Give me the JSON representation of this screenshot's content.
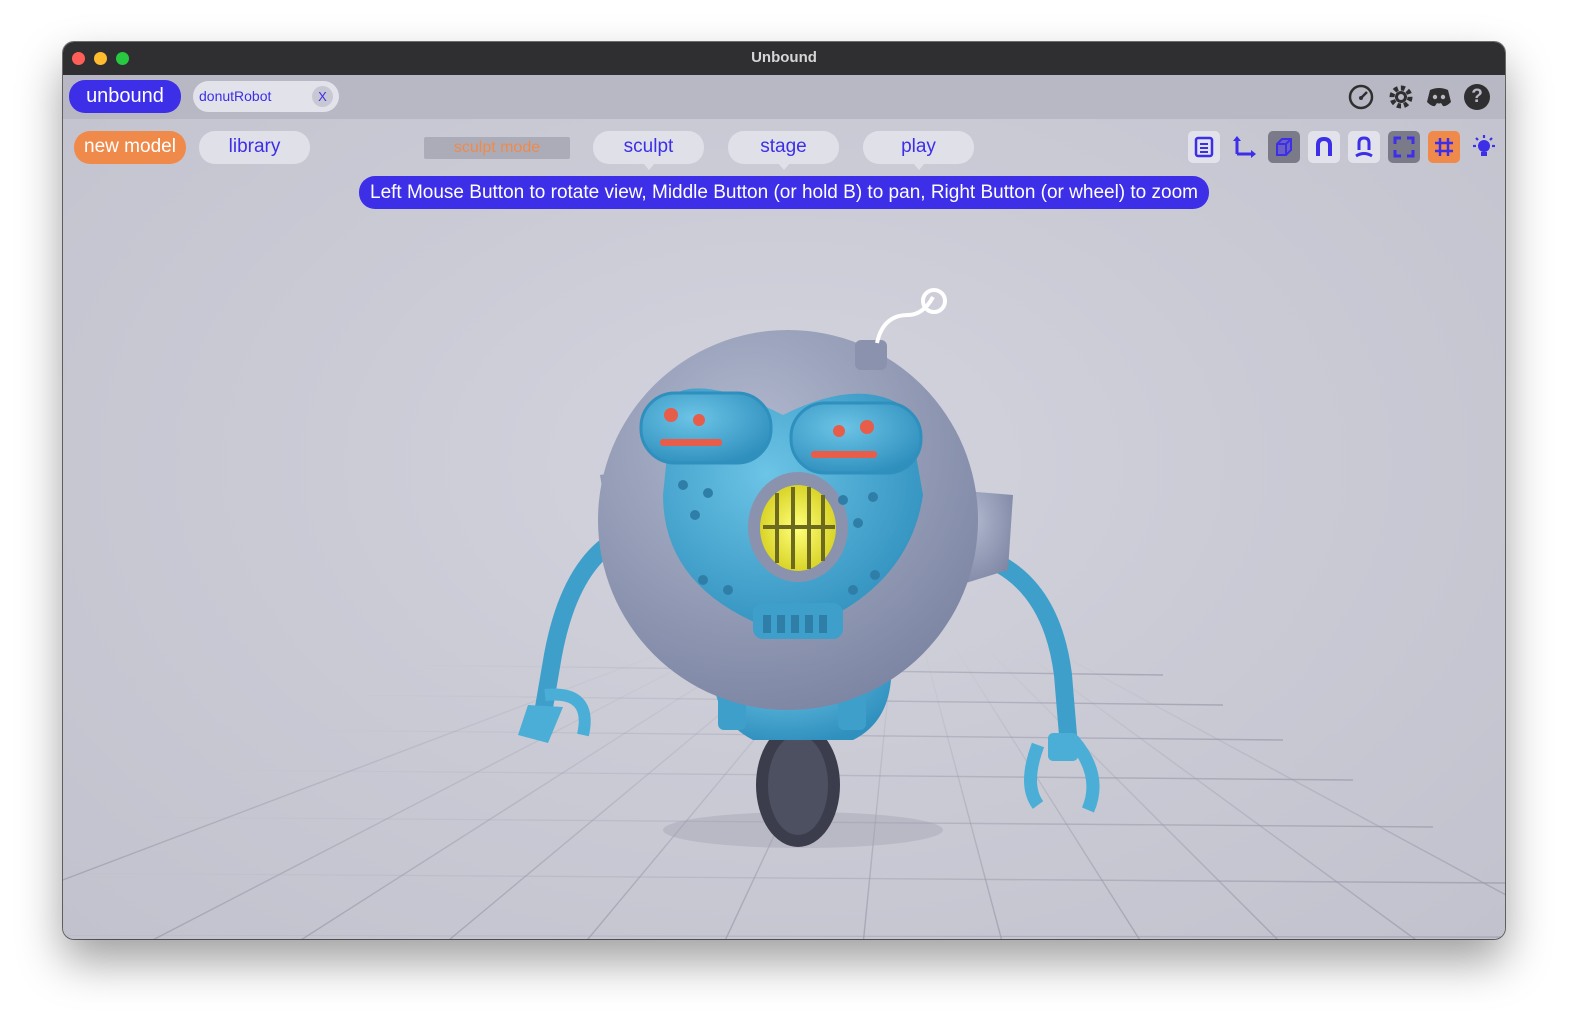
{
  "window": {
    "title": "Unbound"
  },
  "tabs": {
    "app_tab": "unbound",
    "document_tab": {
      "label": "donutRobot",
      "close_label": "X"
    }
  },
  "top_right_icons": [
    "performance-icon",
    "settings-icon",
    "discord-icon",
    "help-icon"
  ],
  "help_glyph": "?",
  "toolbar": {
    "new_model": "new model",
    "library": "library",
    "sculpt_mode": "sculpt mode",
    "modes": [
      "sculpt",
      "stage",
      "play"
    ]
  },
  "hint": "Left Mouse Button to rotate view, Middle Button (or hold B) to pan, Right Button (or wheel) to zoom",
  "view_tools": [
    {
      "icon": "outline-list-icon",
      "active": false
    },
    {
      "icon": "axis-gizmo-icon",
      "active": false
    },
    {
      "icon": "wireframe-cube-icon",
      "active": true
    },
    {
      "icon": "magnet-icon",
      "active": false
    },
    {
      "icon": "snap-person-icon",
      "active": false
    },
    {
      "icon": "frame-selection-icon",
      "active": true
    },
    {
      "icon": "grid-icon",
      "active": true
    },
    {
      "icon": "lighting-icon",
      "active": false
    }
  ],
  "colors": {
    "accent": "#3d2ee8",
    "orange": "#f08a4b",
    "viewport": "#cbcbd6",
    "robot_blue": "#4aaed6",
    "robot_gray": "#9ba3bd"
  }
}
